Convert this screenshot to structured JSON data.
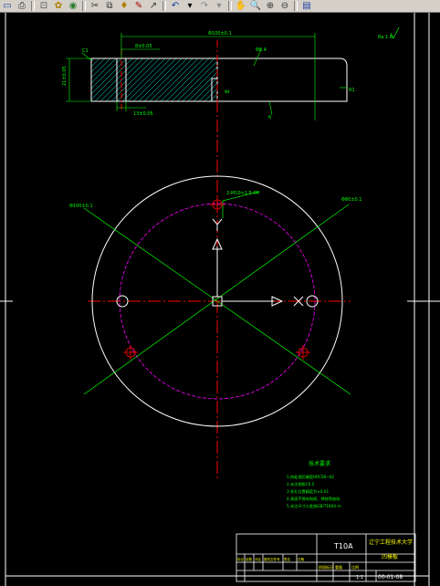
{
  "toolbar": {
    "buttons": [
      {
        "name": "save-button",
        "glyph": "▭",
        "color": "#1a3fa8"
      },
      {
        "name": "print-button",
        "glyph": "⎙",
        "color": "#333"
      },
      {
        "name": "preview-button",
        "glyph": "⊡",
        "color": "#555"
      },
      {
        "name": "publish-button",
        "glyph": "✿",
        "color": "#b07a00"
      },
      {
        "name": "plot-button",
        "glyph": "◉",
        "color": "#2a7a2a"
      },
      {
        "name": "cut-button",
        "glyph": "✂",
        "color": "#333"
      },
      {
        "name": "copy-button",
        "glyph": "⧉",
        "color": "#333"
      },
      {
        "name": "match-properties-button",
        "glyph": "♦",
        "color": "#b07a00"
      },
      {
        "name": "pencil-button",
        "glyph": "✎",
        "color": "#a00"
      },
      {
        "name": "paste-button",
        "glyph": "↗",
        "color": "#333"
      },
      {
        "name": "undo-button",
        "glyph": "↶",
        "color": "#1a3fa8"
      },
      {
        "name": "undo-dropdown",
        "glyph": "▾",
        "color": "#000"
      },
      {
        "name": "redo-button",
        "glyph": "↷",
        "color": "#888"
      },
      {
        "name": "redo-dropdown",
        "glyph": "▾",
        "color": "#888"
      },
      {
        "name": "pan-button",
        "glyph": "✋",
        "color": "#a00"
      },
      {
        "name": "zoom-realtime-button",
        "glyph": "🔍",
        "color": "#333"
      },
      {
        "name": "zoom-window-button",
        "glyph": "⊕",
        "color": "#333"
      },
      {
        "name": "zoom-previous-button",
        "glyph": "⊖",
        "color": "#333"
      },
      {
        "name": "properties-button",
        "glyph": "▤",
        "color": "#1a3fa8"
      }
    ]
  },
  "colors": {
    "background": "#000000",
    "outline": "#ffffff",
    "dimension": "#00ff00",
    "centerline": "#ff0000",
    "bolt_circle": "#ff00ff",
    "hatch": "#00ffff",
    "text": "#00ff00",
    "title_block_text": "#ffff00"
  },
  "drawing": {
    "dim_overall_width": "Φ100±0.1",
    "dim_bore_depth": "8±0.05",
    "dim_hole_dia": "Φ8.4",
    "dim_slot_right": "Φ4",
    "dim_height_left": "21±0.05",
    "dim_chamfer": "C1",
    "dim_radius": "R1",
    "dim_bottom": "6",
    "dim_bottom_left": "13±0.05",
    "note_top_right": "Ra 1.6",
    "callout_holes": "2-M10×1.5-6H",
    "callout_outer": "Φ100±0.1",
    "callout_pcd": "Φ80±0.1",
    "tech_title": "技术要求",
    "tech_notes": [
      "1.热处理后硬度HRC58~62",
      "2.未注倒角C0.5",
      "3.各孔位置精度为±0.01",
      "4.表面不得有划痕、锈蚀等缺陷",
      "5.未注尺寸公差按GB/T1804-m"
    ]
  },
  "title_block": {
    "material": "T10A",
    "school": "辽宁工程技术大学",
    "part_name": "凹模板",
    "sheet_code": "00-01-08",
    "scale": "1:1",
    "row_labels": [
      "标记",
      "处数",
      "分区",
      "更改文件号",
      "签名",
      "日期"
    ],
    "stage_label": "阶段标记",
    "weight_label": "重量",
    "scale_label": "比例"
  }
}
